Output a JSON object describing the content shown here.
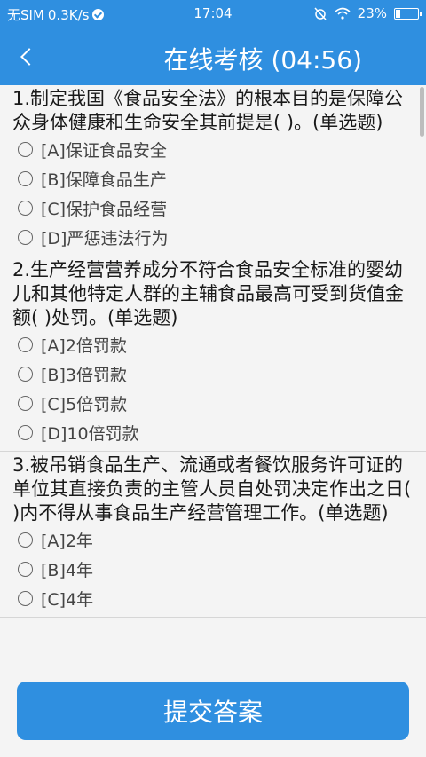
{
  "status_bar": {
    "carrier": "无SIM",
    "speed": "0.3K/s",
    "time": "17:04",
    "battery": "23%",
    "battery_level": 0.23
  },
  "header": {
    "title": "在线考核 (04:56)"
  },
  "questions": [
    {
      "text": "1.制定我国《食品安全法》的根本目的是保障公众身体健康和生命安全其前提是( )。(单选题)",
      "options": [
        "[A]保证食品安全",
        "[B]保障食品生产",
        "[C]保护食品经营",
        "[D]严惩违法行为"
      ]
    },
    {
      "text": "2.生产经营营养成分不符合食品安全标准的婴幼儿和其他特定人群的主辅食品最高可受到货值金额(  )处罚。(单选题)",
      "options": [
        "[A]2倍罚款",
        "[B]3倍罚款",
        "[C]5倍罚款",
        "[D]10倍罚款"
      ]
    },
    {
      "text": "3.被吊销食品生产、流通或者餐饮服务许可证的单位其直接负责的主管人员自处罚决定作出之日( )内不得从事食品生产经营管理工作。(单选题)",
      "options": [
        "[A]2年",
        "[B]4年",
        "[C]4年"
      ]
    }
  ],
  "submit_label": "提交答案"
}
